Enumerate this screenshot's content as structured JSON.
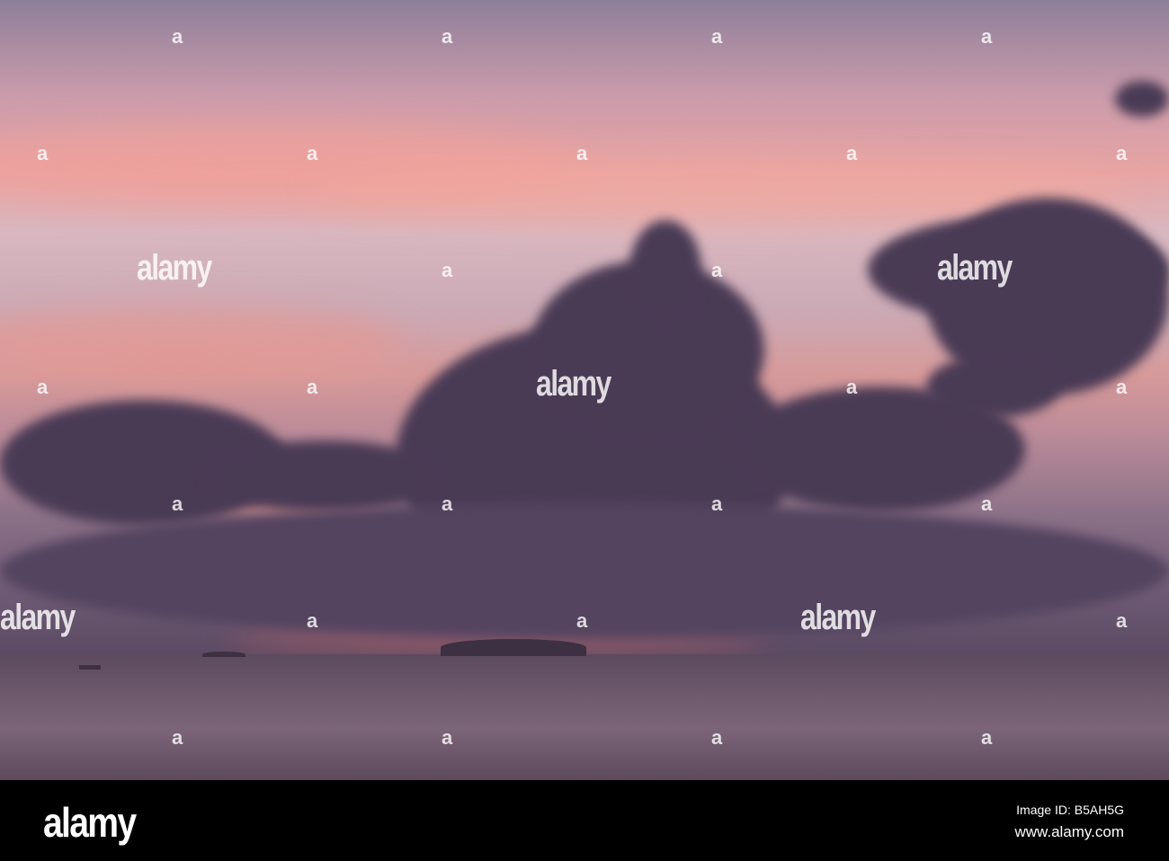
{
  "watermark": {
    "text": "alamy",
    "mark": "a"
  },
  "footer": {
    "logo": "alamy",
    "image_id": "Image ID: B5AH5G",
    "website": "www.alamy.com"
  }
}
